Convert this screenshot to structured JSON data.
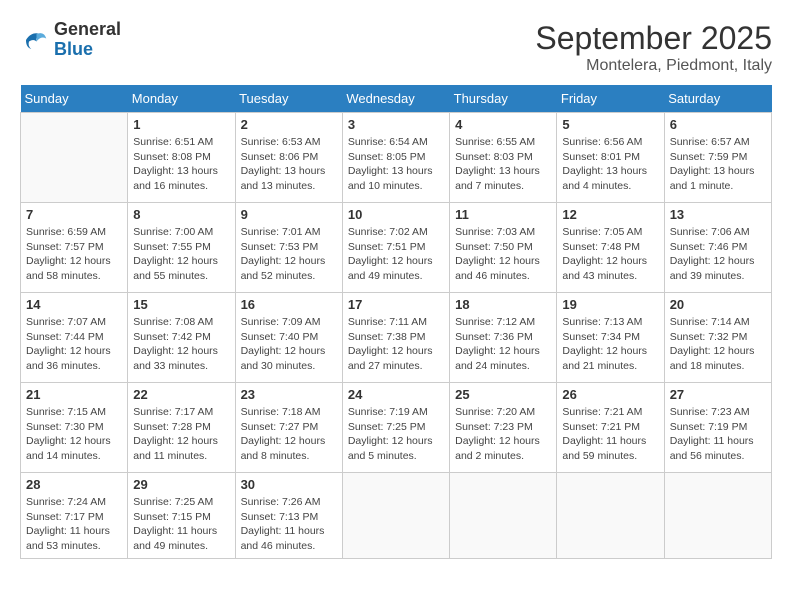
{
  "header": {
    "logo_line1": "General",
    "logo_line2": "Blue",
    "month": "September 2025",
    "location": "Montelera, Piedmont, Italy"
  },
  "weekdays": [
    "Sunday",
    "Monday",
    "Tuesday",
    "Wednesday",
    "Thursday",
    "Friday",
    "Saturday"
  ],
  "weeks": [
    [
      {
        "day": null
      },
      {
        "day": 1,
        "sunrise": "6:51 AM",
        "sunset": "8:08 PM",
        "daylight": "13 hours and 16 minutes."
      },
      {
        "day": 2,
        "sunrise": "6:53 AM",
        "sunset": "8:06 PM",
        "daylight": "13 hours and 13 minutes."
      },
      {
        "day": 3,
        "sunrise": "6:54 AM",
        "sunset": "8:05 PM",
        "daylight": "13 hours and 10 minutes."
      },
      {
        "day": 4,
        "sunrise": "6:55 AM",
        "sunset": "8:03 PM",
        "daylight": "13 hours and 7 minutes."
      },
      {
        "day": 5,
        "sunrise": "6:56 AM",
        "sunset": "8:01 PM",
        "daylight": "13 hours and 4 minutes."
      },
      {
        "day": 6,
        "sunrise": "6:57 AM",
        "sunset": "7:59 PM",
        "daylight": "13 hours and 1 minute."
      }
    ],
    [
      {
        "day": 7,
        "sunrise": "6:59 AM",
        "sunset": "7:57 PM",
        "daylight": "12 hours and 58 minutes."
      },
      {
        "day": 8,
        "sunrise": "7:00 AM",
        "sunset": "7:55 PM",
        "daylight": "12 hours and 55 minutes."
      },
      {
        "day": 9,
        "sunrise": "7:01 AM",
        "sunset": "7:53 PM",
        "daylight": "12 hours and 52 minutes."
      },
      {
        "day": 10,
        "sunrise": "7:02 AM",
        "sunset": "7:51 PM",
        "daylight": "12 hours and 49 minutes."
      },
      {
        "day": 11,
        "sunrise": "7:03 AM",
        "sunset": "7:50 PM",
        "daylight": "12 hours and 46 minutes."
      },
      {
        "day": 12,
        "sunrise": "7:05 AM",
        "sunset": "7:48 PM",
        "daylight": "12 hours and 43 minutes."
      },
      {
        "day": 13,
        "sunrise": "7:06 AM",
        "sunset": "7:46 PM",
        "daylight": "12 hours and 39 minutes."
      }
    ],
    [
      {
        "day": 14,
        "sunrise": "7:07 AM",
        "sunset": "7:44 PM",
        "daylight": "12 hours and 36 minutes."
      },
      {
        "day": 15,
        "sunrise": "7:08 AM",
        "sunset": "7:42 PM",
        "daylight": "12 hours and 33 minutes."
      },
      {
        "day": 16,
        "sunrise": "7:09 AM",
        "sunset": "7:40 PM",
        "daylight": "12 hours and 30 minutes."
      },
      {
        "day": 17,
        "sunrise": "7:11 AM",
        "sunset": "7:38 PM",
        "daylight": "12 hours and 27 minutes."
      },
      {
        "day": 18,
        "sunrise": "7:12 AM",
        "sunset": "7:36 PM",
        "daylight": "12 hours and 24 minutes."
      },
      {
        "day": 19,
        "sunrise": "7:13 AM",
        "sunset": "7:34 PM",
        "daylight": "12 hours and 21 minutes."
      },
      {
        "day": 20,
        "sunrise": "7:14 AM",
        "sunset": "7:32 PM",
        "daylight": "12 hours and 18 minutes."
      }
    ],
    [
      {
        "day": 21,
        "sunrise": "7:15 AM",
        "sunset": "7:30 PM",
        "daylight": "12 hours and 14 minutes."
      },
      {
        "day": 22,
        "sunrise": "7:17 AM",
        "sunset": "7:28 PM",
        "daylight": "12 hours and 11 minutes."
      },
      {
        "day": 23,
        "sunrise": "7:18 AM",
        "sunset": "7:27 PM",
        "daylight": "12 hours and 8 minutes."
      },
      {
        "day": 24,
        "sunrise": "7:19 AM",
        "sunset": "7:25 PM",
        "daylight": "12 hours and 5 minutes."
      },
      {
        "day": 25,
        "sunrise": "7:20 AM",
        "sunset": "7:23 PM",
        "daylight": "12 hours and 2 minutes."
      },
      {
        "day": 26,
        "sunrise": "7:21 AM",
        "sunset": "7:21 PM",
        "daylight": "11 hours and 59 minutes."
      },
      {
        "day": 27,
        "sunrise": "7:23 AM",
        "sunset": "7:19 PM",
        "daylight": "11 hours and 56 minutes."
      }
    ],
    [
      {
        "day": 28,
        "sunrise": "7:24 AM",
        "sunset": "7:17 PM",
        "daylight": "11 hours and 53 minutes."
      },
      {
        "day": 29,
        "sunrise": "7:25 AM",
        "sunset": "7:15 PM",
        "daylight": "11 hours and 49 minutes."
      },
      {
        "day": 30,
        "sunrise": "7:26 AM",
        "sunset": "7:13 PM",
        "daylight": "11 hours and 46 minutes."
      },
      {
        "day": null
      },
      {
        "day": null
      },
      {
        "day": null
      },
      {
        "day": null
      }
    ]
  ]
}
